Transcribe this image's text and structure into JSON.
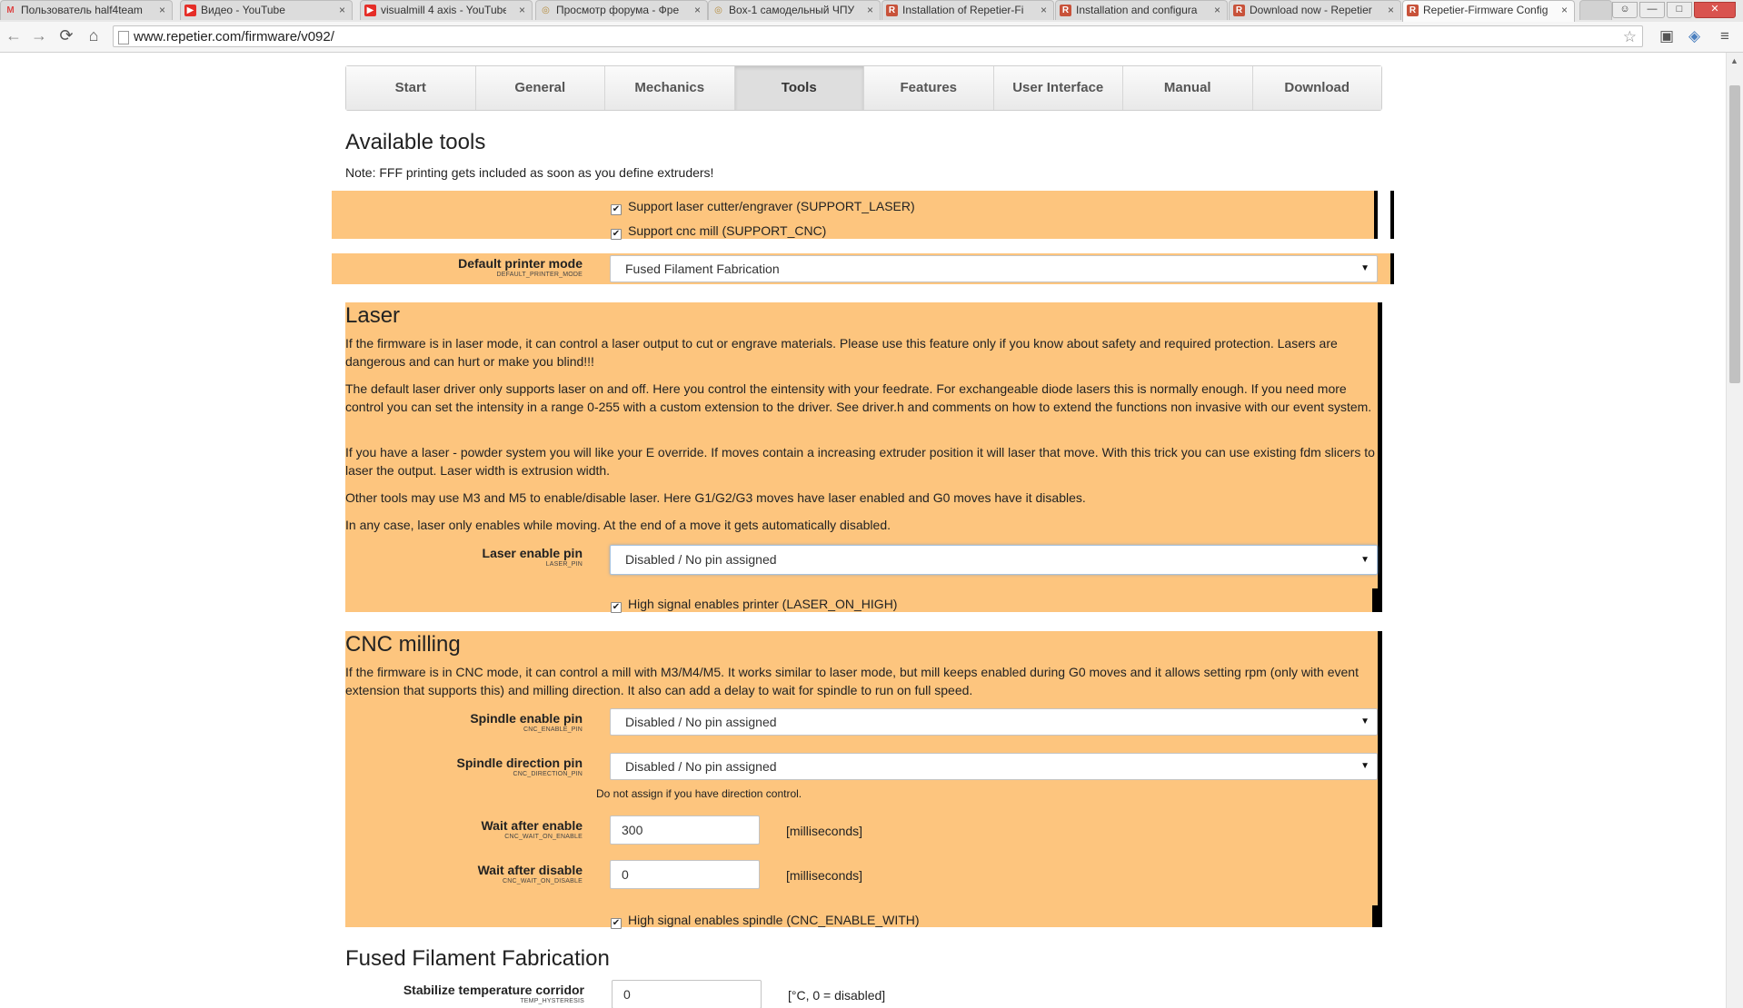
{
  "browser": {
    "tabs": [
      {
        "title": "Пользователь half4team",
        "icon": "gmail-icon",
        "active": false
      },
      {
        "title": "Видео - YouTube",
        "icon": "youtube-icon",
        "active": false
      },
      {
        "title": "visualmill 4 axis - YouTube",
        "icon": "youtube-icon",
        "active": false
      },
      {
        "title": "Просмотр форума - Фре",
        "icon": "forum-icon",
        "active": false
      },
      {
        "title": "Box-1 самодельный ЧПУ",
        "icon": "forum-icon",
        "active": false
      },
      {
        "title": "Installation of Repetier-Fi",
        "icon": "repetier-icon",
        "active": false
      },
      {
        "title": "Installation and configura",
        "icon": "repetier-icon",
        "active": false
      },
      {
        "title": "Download now - Repetier",
        "icon": "repetier-icon",
        "active": false
      },
      {
        "title": "Repetier-Firmware Config",
        "icon": "repetier-icon",
        "active": true
      }
    ],
    "tab_close_glyph": "×",
    "url": "www.repetier.com/firmware/v092/"
  },
  "nav": {
    "tabs": [
      "Start",
      "General",
      "Mechanics",
      "Tools",
      "Features",
      "User Interface",
      "Manual",
      "Download"
    ],
    "active": "Tools"
  },
  "tools": {
    "title": "Available tools",
    "note": "Note: FFF printing gets included as soon as you define extruders!",
    "support_laser": {
      "label": "Support laser cutter/engraver (SUPPORT_LASER)",
      "checked": true
    },
    "support_cnc": {
      "label": "Support cnc mill (SUPPORT_CNC)",
      "checked": true
    },
    "default_mode": {
      "label": "Default printer mode",
      "var": "DEFAULT_PRINTER_MODE",
      "value": "Fused Filament Fabrication"
    }
  },
  "laser": {
    "title": "Laser",
    "paragraphs": [
      "If the firmware is in laser mode, it can control a laser output to cut or engrave materials. Please use this feature only if you know about safety and required protection. Lasers are dangerous and can hurt or make you blind!!!",
      "The default laser driver only supports laser on and off. Here you control the eintensity with your feedrate. For exchangeable diode lasers this is normally enough. If you need more control you can set the intensity in a range 0-255 with a custom extension to the driver. See driver.h and comments on how to extend the functions non invasive with our event system.",
      "If you have a laser - powder system you will like your E override. If moves contain a increasing extruder position it will laser that move. With this trick you can use existing fdm slicers to laser the output. Laser width is extrusion width.",
      "Other tools may use M3 and M5 to enable/disable laser. Here G1/G2/G3 moves have laser enabled and G0 moves have it disables.",
      "In any case, laser only enables while moving. At the end of a move it gets automatically disabled."
    ],
    "pin": {
      "label": "Laser enable pin",
      "var": "LASER_PIN",
      "value": "Disabled / No pin assigned"
    },
    "on_high": {
      "label": "High signal enables printer (LASER_ON_HIGH)",
      "checked": true
    }
  },
  "cnc": {
    "title": "CNC milling",
    "paragraph": "If the firmware is in CNC mode, it can control a mill with M3/M4/M5. It works similar to laser mode, but mill keeps enabled during G0 moves and it allows setting rpm (only with event extension that supports this) and milling direction. It also can add a delay to wait for spindle to run on full speed.",
    "enable_pin": {
      "label": "Spindle enable pin",
      "var": "CNC_ENABLE_PIN",
      "value": "Disabled / No pin assigned"
    },
    "direction_pin": {
      "label": "Spindle direction pin",
      "var": "CNC_DIRECTION_PIN",
      "value": "Disabled / No pin assigned"
    },
    "direction_hint": "Do not assign if you have direction control.",
    "wait_enable": {
      "label": "Wait after enable",
      "var": "CNC_WAIT_ON_ENABLE",
      "value": "300",
      "unit": "[milliseconds]"
    },
    "wait_disable": {
      "label": "Wait after disable",
      "var": "CNC_WAIT_ON_DISABLE",
      "value": "0",
      "unit": "[milliseconds]"
    },
    "enable_with": {
      "label": "High signal enables spindle (CNC_ENABLE_WITH)",
      "checked": true
    }
  },
  "fff": {
    "title": "Fused Filament Fabrication",
    "hysteresis": {
      "label": "Stabilize temperature corridor",
      "var": "TEMP_HYSTERESIS",
      "value": "0",
      "unit": "[°C, 0 = disabled]"
    }
  },
  "glyphs": {
    "check": "✔",
    "caret": "▼",
    "back": "←",
    "forward": "→",
    "reload": "⟳",
    "home": "⌂",
    "star": "☆",
    "menu": "≡",
    "minimize": "—",
    "maximize": "□",
    "close": "✕",
    "scroll_up": "▲"
  },
  "colors": {
    "section_bg": "#fdc57e",
    "accent_bar": "#000000"
  }
}
